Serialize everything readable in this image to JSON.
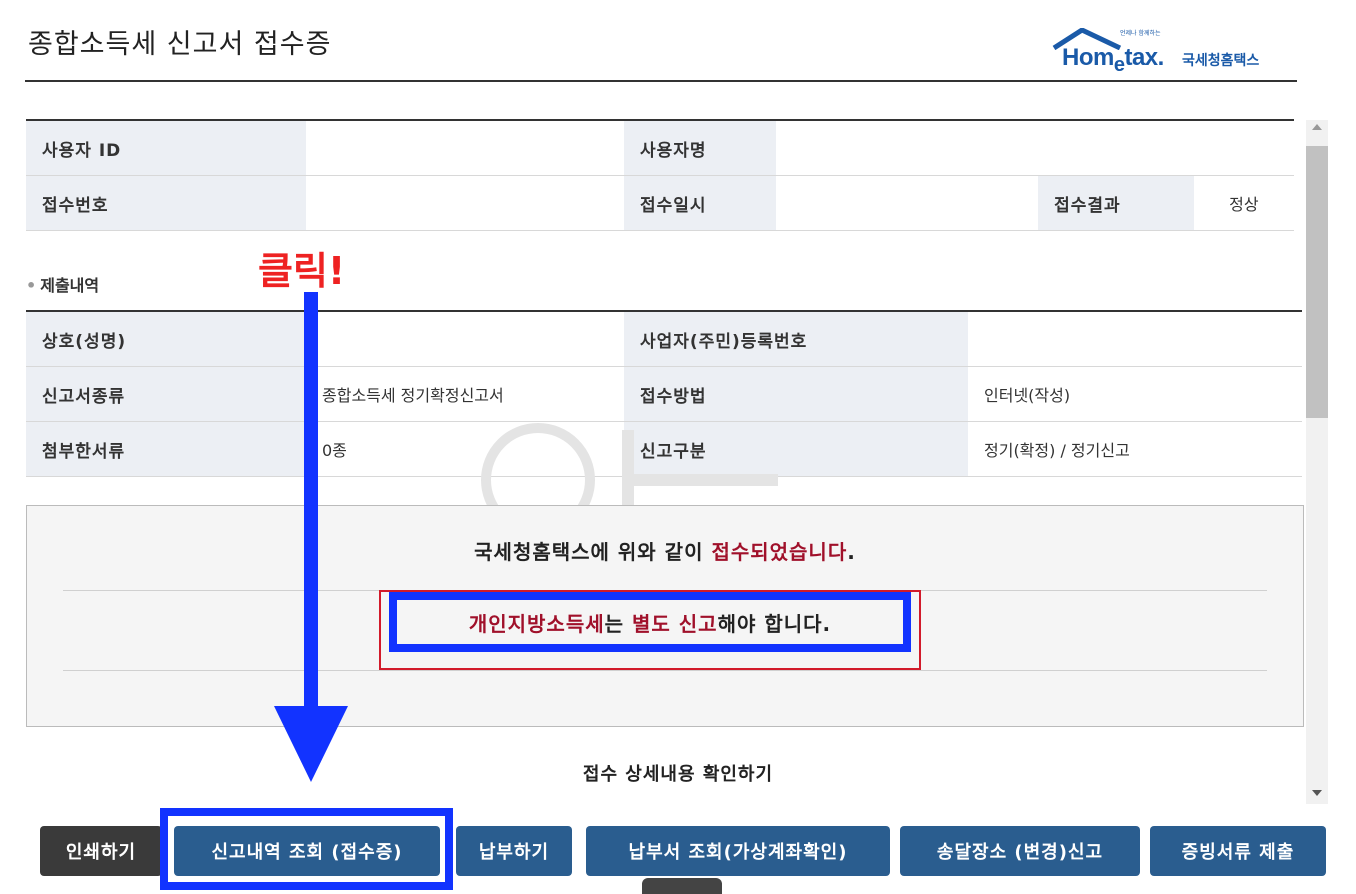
{
  "page": {
    "title": "종합소득세 신고서 접수증"
  },
  "logo": {
    "main": "Homtax",
    "e": "e",
    "dot": ".",
    "sub": "국세청홈택스",
    "tiny": "언제나 함께하는"
  },
  "user_table": {
    "user_id_label": "사용자 ID",
    "user_id_value": "",
    "user_name_label": "사용자명",
    "user_name_value": "",
    "receipt_no_label": "접수번호",
    "receipt_no_value": "",
    "receipt_time_label": "접수일시",
    "receipt_time_value": "",
    "receipt_result_label": "접수결과",
    "receipt_result_value": "정상"
  },
  "section": {
    "label": "제출내역"
  },
  "submit_table": {
    "name_label": "상호(성명)",
    "name_value": "",
    "reg_no_label": "사업자(주민)등록번호",
    "reg_no_value": "",
    "form_type_label": "신고서종류",
    "form_type_value": "종합소득세 정기확정신고서",
    "method_label": "접수방법",
    "method_value": "인터넷(작성)",
    "attach_label": "첨부한서류",
    "attach_value": "0종",
    "category_label": "신고구분",
    "category_value": "정기(확정) / 정기신고"
  },
  "notice": {
    "line1_pre": "국세청홈택스에 위와 같이 ",
    "line1_red": "접수되었습니다",
    "line1_post": ".",
    "line2_red1": "개인지방소득세",
    "line2_mid": "는 ",
    "line2_red2": "별도 신고",
    "line2_post": "해야 합니다."
  },
  "detail_link": "접수 상세내용 확인하기",
  "annotation": {
    "click": "클릭!"
  },
  "buttons": {
    "print": "인쇄하기",
    "history": "신고내역 조회 (접수증)",
    "pay": "납부하기",
    "bill": "납부서 조회(가상계좌확인)",
    "address": "송달장소 (변경)신고",
    "evidence": "증빙서류 제출"
  },
  "colors": {
    "highlight_blue": "#1233ff",
    "accent_red": "#a0102a",
    "click_red": "#ee2222",
    "button_blue": "#2a5d8f",
    "button_dark": "#3a3a3a"
  }
}
